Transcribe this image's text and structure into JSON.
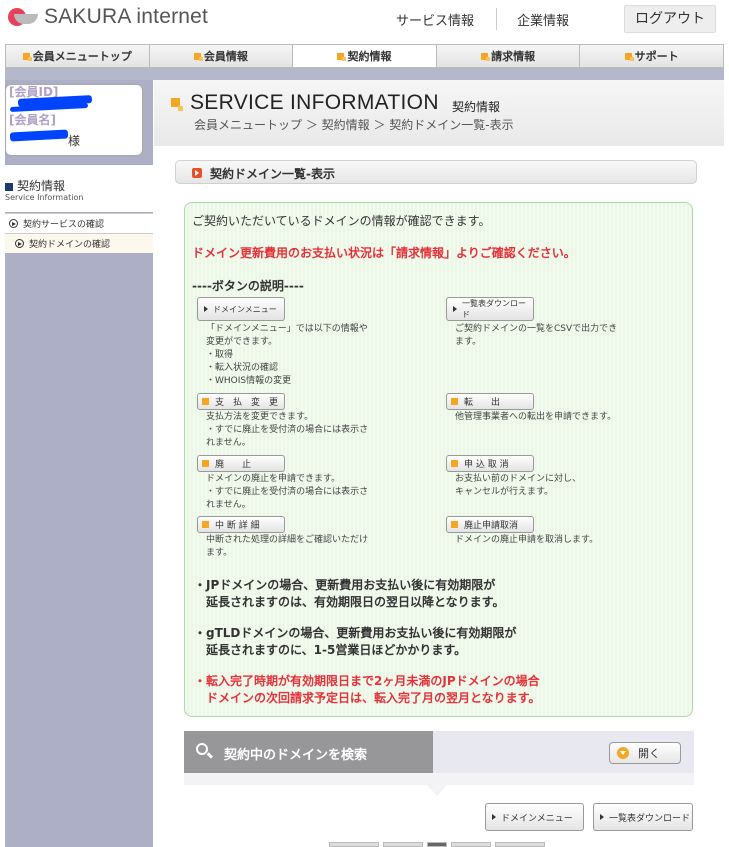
{
  "header": {
    "logo_text": "SAKURA internet",
    "links": [
      "サービス情報",
      "企業情報"
    ],
    "logout": "ログアウト"
  },
  "nav": {
    "items": [
      "会員メニュートップ",
      "会員情報",
      "契約情報",
      "請求情報",
      "サポート"
    ],
    "active_index": 2
  },
  "member": {
    "id_label": "[会員ID]",
    "name_label": "[会員名]",
    "name_suffix": "様"
  },
  "sidebar": {
    "section_title": "契約情報",
    "section_sub": "Service Information",
    "items": [
      "契約サービスの確認",
      "契約ドメインの確認"
    ]
  },
  "page": {
    "title": "SERVICE INFORMATION",
    "subtitle": "契約情報",
    "breadcrumb": "会員メニュートップ ＞ 契約情報 ＞ 契約ドメイン一覧-表示",
    "section_heading": "契約ドメイン一覧-表示"
  },
  "info": {
    "intro": "ご契約いただいているドメインの情報が確認できます。",
    "payment_note": "ドメイン更新費用のお支払い状況は「請求情報」よりご確認ください。",
    "buttons_heading": "----ボタンの説明----",
    "buttons": [
      {
        "label": "ドメインメニュー",
        "desc": "「ドメインメニュー」では以下の情報や\n変更ができます。\n・取得\n・転入状況の確認\n・WHOIS情報の変更"
      },
      {
        "label": "一覧表ダウンロード",
        "desc": "ご契約ドメインの一覧をCSVで出力でき\nます。"
      },
      {
        "label": "支　払　変　更",
        "desc": "支払方法を変更できます。\n・すでに廃止を受付済の場合には表示さ\nれません。"
      },
      {
        "label": "転　　出",
        "desc": "他管理事業者への転出を申請できます。"
      },
      {
        "label": "廃　　止",
        "desc": "ドメインの廃止を申請できます。\n・すでに廃止を受付済の場合には表示さ\nれません。"
      },
      {
        "label": "申 込 取 消",
        "desc": "お支払い前のドメインに対し、\nキャンセルが行えます。"
      },
      {
        "label": "中 断 詳 細",
        "desc": "中断された処理の詳細をご確認いただけ\nます。"
      },
      {
        "label": "廃止申請取消",
        "desc": "ドメインの廃止申請を取消します。"
      }
    ],
    "notes": [
      "・JPドメインの場合、更新費用お支払い後に有効期限が\n　延長されますのは、有効期限日の翌日以降となります。",
      "・gTLDドメインの場合、更新費用お支払い後に有効期限が\n　延長されますのに、1-5営業日ほどかかります。",
      "・転入完了時期が有効期限日まで2ヶ月未満のJPドメインの場合\n　ドメインの次回請求予定日は、転入完了月の翌月となります。"
    ]
  },
  "search": {
    "title": "契約中のドメインを検索",
    "open_label": "開く"
  },
  "bottom_buttons": [
    "ドメインメニュー",
    "一覧表ダウンロード"
  ],
  "colors": {
    "accent": "#f5a623",
    "warning": "#e5323a",
    "sidebar": "#adafc6",
    "info_border": "#a8dca0"
  }
}
